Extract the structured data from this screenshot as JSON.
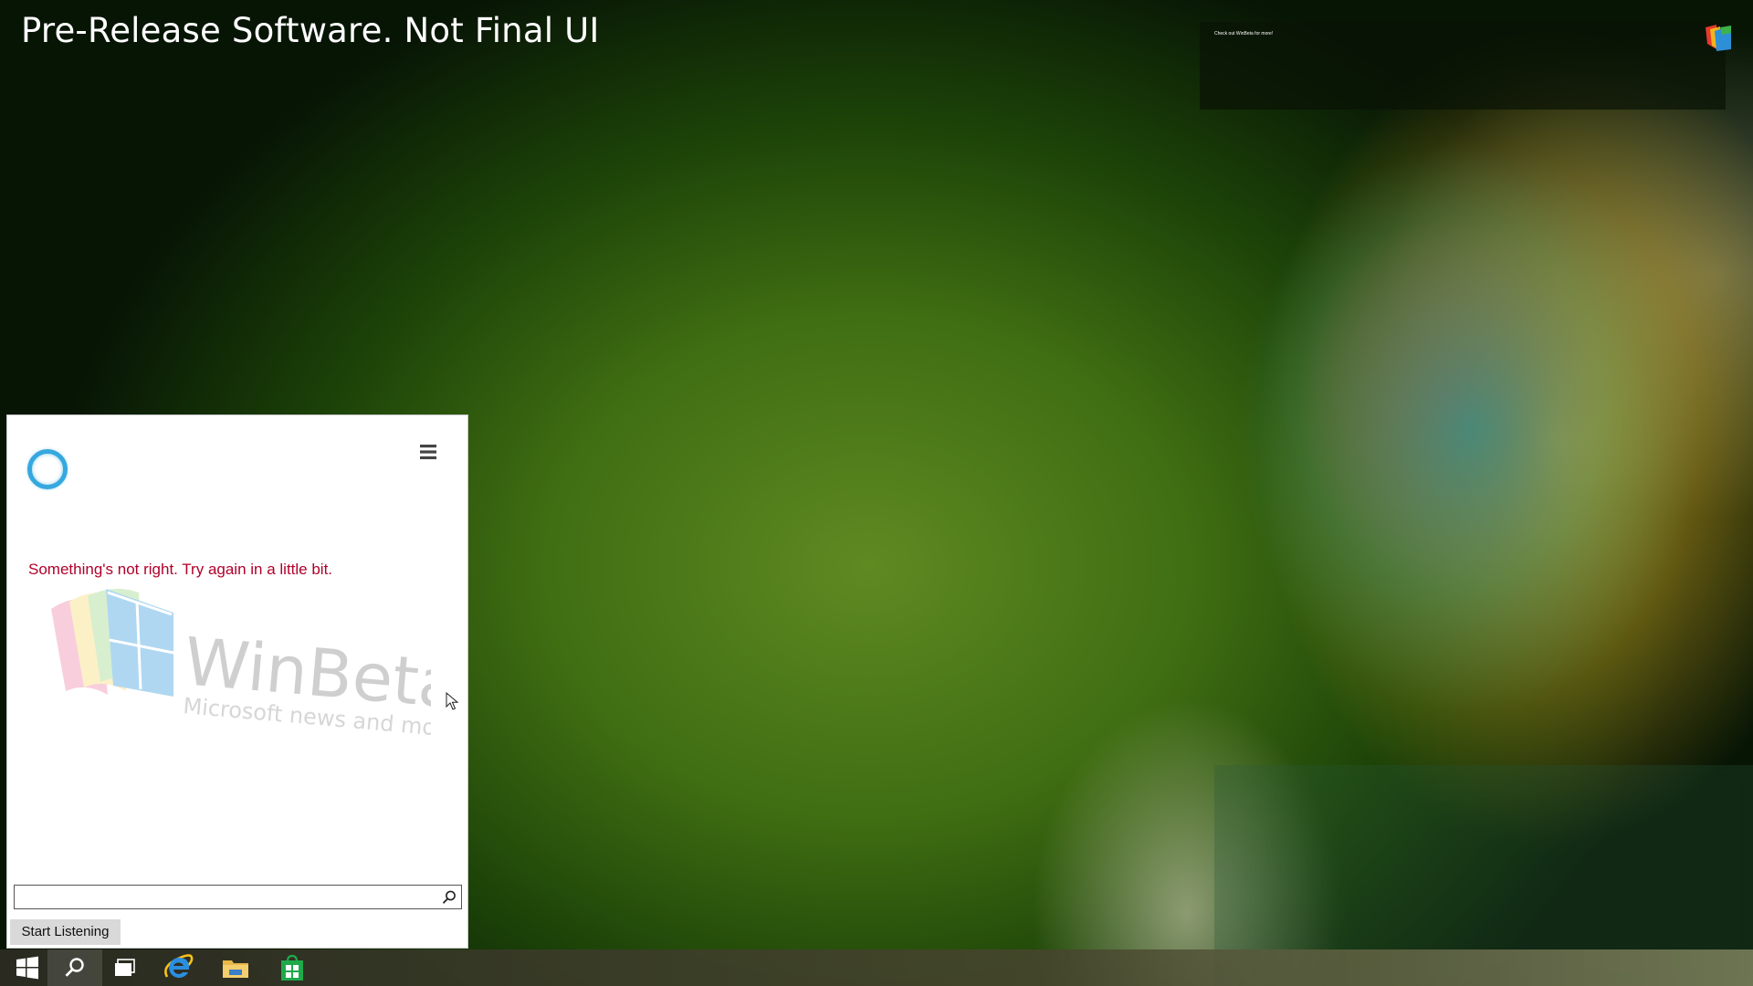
{
  "desktop": {
    "watermark": "Pre-Release Software. Not Final UI",
    "notification": {
      "text": "Check out WinBeta for more!",
      "icon": "winbeta-logo-icon"
    }
  },
  "cortana": {
    "error_message": "Something's not right. Try again in a little bit.",
    "menu_icon": "hamburger-menu-icon",
    "watermark_logo": {
      "title": "WinBeta",
      "tagline": "Microsoft news and more"
    },
    "search": {
      "value": "",
      "placeholder": "",
      "icon": "search-icon"
    },
    "start_listening_label": "Start Listening"
  },
  "taskbar": {
    "items": [
      {
        "name": "start",
        "icon": "windows-logo-icon"
      },
      {
        "name": "search",
        "icon": "search-icon"
      },
      {
        "name": "task-view",
        "icon": "task-view-icon"
      },
      {
        "name": "internet-explorer",
        "icon": "internet-explorer-icon"
      },
      {
        "name": "file-explorer",
        "icon": "folder-icon"
      },
      {
        "name": "store",
        "icon": "store-icon"
      }
    ]
  },
  "colors": {
    "accent": "#36a8df",
    "error": "#b0002a",
    "button_bg": "#d9d9d9"
  }
}
